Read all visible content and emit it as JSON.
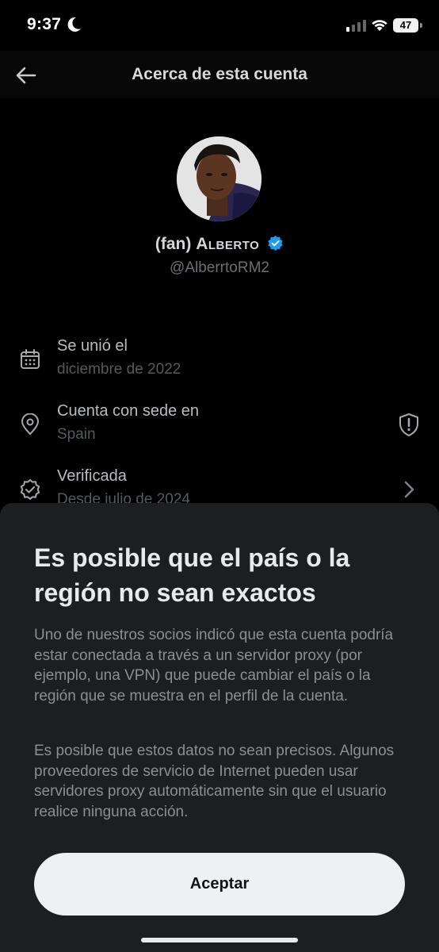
{
  "status_bar": {
    "time": "9:37",
    "battery": "47",
    "icons": [
      "moon-icon",
      "cellular-signal-icon",
      "wifi-icon",
      "battery-icon"
    ]
  },
  "header": {
    "title": "Acerca de esta cuenta",
    "back_icon": "arrow-left-icon"
  },
  "profile": {
    "name_prefix": "(fan) ",
    "name_main": "Alberto",
    "handle": "@AlberrtoRM2",
    "verified_color": "#1d9bf0"
  },
  "info": [
    {
      "icon": "calendar-icon",
      "title": "Se unió el",
      "subtitle": "diciembre de 2022"
    },
    {
      "icon": "location-pin-icon",
      "title": "Cuenta con sede en",
      "subtitle": "Spain",
      "right_icon": "shield-alert-icon"
    },
    {
      "icon": "verified-badge-icon",
      "title": "Verificada",
      "subtitle": "Desde julio de 2024",
      "right_icon": "chevron-right-icon"
    }
  ],
  "sheet": {
    "title": "Es posible que el país o la región no sean exactos",
    "paragraph1": "Uno de nuestros socios indicó que esta cuenta podría estar conectada a través a un servidor proxy (por ejemplo, una VPN) que puede cambiar el país o la región que se muestra en el perfil de la cuenta.",
    "paragraph2": "Es posible que estos datos no sean precisos. Algunos proveedores de servicio de Internet pueden usar servidores proxy automáticamente sin que el usuario realice ninguna acción.",
    "button_label": "Aceptar"
  },
  "colors": {
    "background": "#000000",
    "sheet_background": "#1d1e20",
    "button_background": "#eef0f1"
  }
}
